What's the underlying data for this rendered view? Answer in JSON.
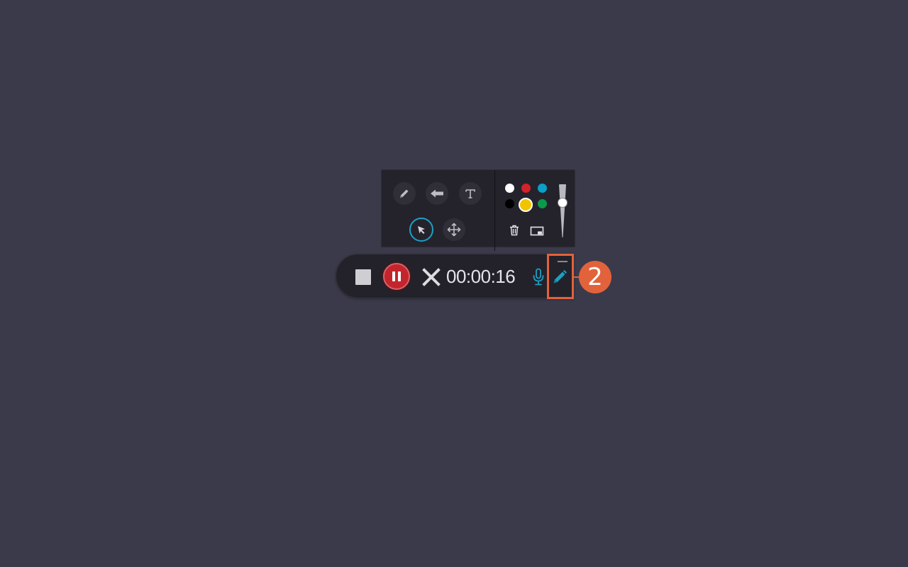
{
  "draw_panel": {
    "tools": [
      {
        "id": "pen",
        "icon": "pencil-icon"
      },
      {
        "id": "arrow",
        "icon": "arrow-left-icon"
      },
      {
        "id": "text",
        "icon": "text-icon"
      },
      {
        "id": "select",
        "icon": "cursor-icon",
        "active": true
      },
      {
        "id": "move",
        "icon": "move-icon"
      }
    ],
    "colors": [
      "#ffffff",
      "#d2232a",
      "#0aa0c8",
      "#000000",
      "#f2c400",
      "#0a9a4a"
    ],
    "selected_color": "#f2c400",
    "actions": [
      {
        "id": "clear",
        "icon": "trash-icon"
      },
      {
        "id": "whiteboard",
        "icon": "whiteboard-icon"
      }
    ],
    "size_level": 0.3
  },
  "recording_bar": {
    "timer": "00:00:16",
    "buttons": {
      "stop": "stop-icon",
      "pause": "pause-icon",
      "cancel": "close-icon",
      "microphone": "microphone-icon",
      "annotate": "pencil-icon",
      "minimize": "minimize-icon"
    },
    "accent_color": "#1e9fc4",
    "record_color": "#c4252c"
  },
  "callout": {
    "label": "2",
    "color": "#e2623b"
  }
}
